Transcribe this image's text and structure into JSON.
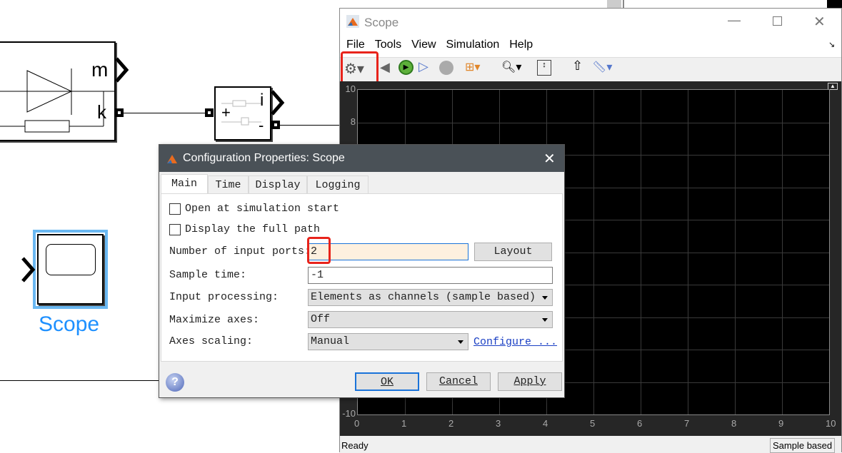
{
  "model": {
    "block1": {
      "port_m": "m",
      "port_k": "k"
    },
    "block2": {
      "port_i": "i",
      "port_plus": "+",
      "port_minus": "-"
    },
    "scope_block": {
      "label": "Scope",
      "color": "#1e90ff"
    }
  },
  "scope_window": {
    "title": "Scope",
    "menu": [
      "File",
      "Tools",
      "View",
      "Simulation",
      "Help"
    ],
    "toolbar": [
      "settings-icon",
      "step-back-icon",
      "run-icon",
      "step-forward-icon",
      "stop-icon",
      "signal-selection-icon",
      "zoom-in-icon",
      "scale-axes-icon",
      "trigger-icon",
      "measurements-icon"
    ],
    "status": "Ready",
    "mode": "Sample based"
  },
  "chart_data": {
    "type": "line",
    "series": [],
    "xlim": [
      0,
      10
    ],
    "ylim": [
      -10,
      10
    ],
    "grid": true,
    "x_ticks": [
      "0",
      "1",
      "2",
      "3",
      "4",
      "5",
      "6",
      "7",
      "8",
      "9",
      "10"
    ],
    "y_ticks_visible": [
      "10",
      "8",
      "-10"
    ],
    "background": "#000000"
  },
  "dialog": {
    "title": "Configuration Properties: Scope",
    "tabs": [
      "Main",
      "Time",
      "Display",
      "Logging"
    ],
    "active_tab": "Main",
    "open_at_start": {
      "label": "Open at simulation start",
      "checked": false
    },
    "full_path": {
      "label": "Display the full path",
      "checked": false
    },
    "num_ports": {
      "label": "Number of input ports:",
      "value": "2",
      "layout": "Layout"
    },
    "sample_time": {
      "label": "Sample time:",
      "value": "-1"
    },
    "input_processing": {
      "label": "Input processing:",
      "value": "Elements as channels (sample based)"
    },
    "maximize_axes": {
      "label": "Maximize axes:",
      "value": "Off"
    },
    "axes_scaling": {
      "label": "Axes scaling:",
      "value": "Manual",
      "configure": "Configure ..."
    },
    "ok": "OK",
    "cancel": "Cancel",
    "apply": "Apply"
  }
}
